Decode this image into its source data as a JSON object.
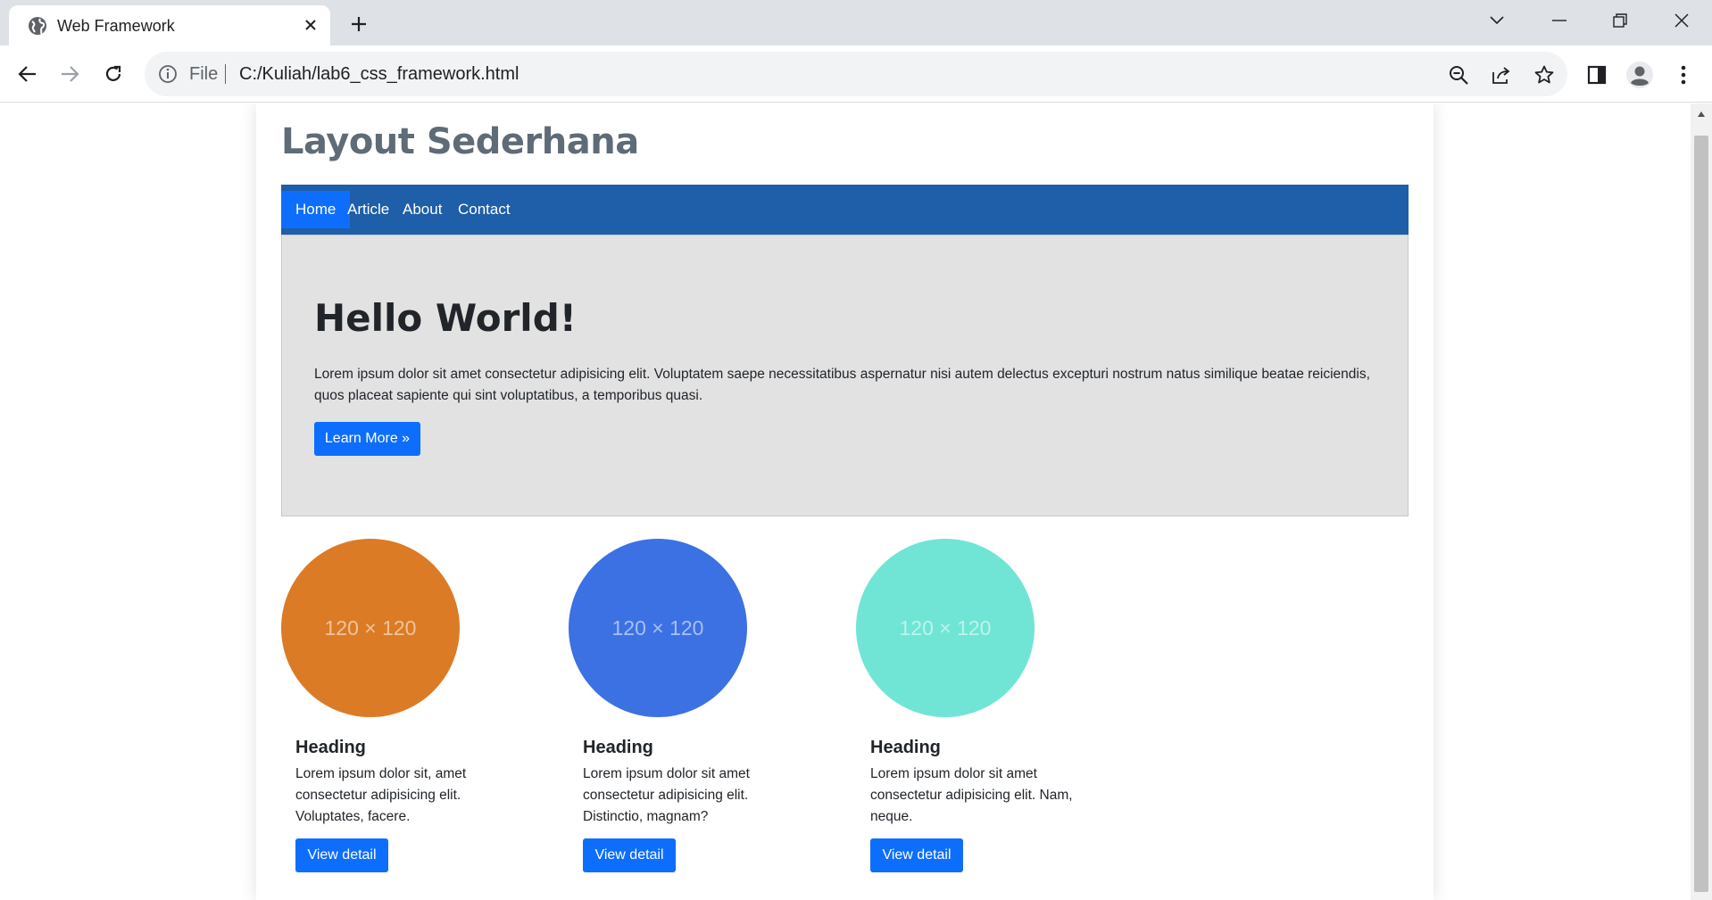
{
  "browser": {
    "tab_title": "Web Framework",
    "omnibox_scheme": "File",
    "url": "C:/Kuliah/lab6_css_framework.html"
  },
  "page": {
    "site_title": "Layout Sederhana",
    "nav": [
      {
        "label": "Home",
        "active": true
      },
      {
        "label": "Article",
        "active": false
      },
      {
        "label": "About",
        "active": false
      },
      {
        "label": "Contact",
        "active": false
      }
    ],
    "hero": {
      "title": "Hello World!",
      "text": "Lorem ipsum dolor sit amet consectetur adipisicing elit. Voluptatem saepe necessitatibus aspernatur nisi autem delectus excepturi nostrum natus similique beatae reiciendis, quos placeat sapiente qui sint voluptatibus, a temporibus quasi.",
      "button": "Learn More »"
    },
    "cards": [
      {
        "placeholder": "120 × 120",
        "color": "#db7b25",
        "heading": "Heading",
        "text": "Lorem ipsum dolor sit, amet consectetur adipisicing elit. Voluptates, facere.",
        "button": "View detail"
      },
      {
        "placeholder": "120 × 120",
        "color": "#3c71e3",
        "heading": "Heading",
        "text": "Lorem ipsum dolor sit amet consectetur adipisicing elit. Distinctio, magnam?",
        "button": "View detail"
      },
      {
        "placeholder": "120 × 120",
        "color": "#70e5d5",
        "heading": "Heading",
        "text": "Lorem ipsum dolor sit amet consectetur adipisicing elit. Nam, neque.",
        "button": "View detail"
      }
    ]
  },
  "colors": {
    "navbar": "#1f5ea8",
    "primary": "#0d6efd",
    "hero_bg": "#e2e2e3"
  },
  "icons": {
    "tab_favicon": "globe-icon",
    "tab_close": "close-icon",
    "new_tab": "plus-icon",
    "back": "back-arrow-icon",
    "forward": "forward-arrow-icon",
    "reload": "reload-icon",
    "site_info": "info-icon",
    "zoom": "zoom-out-icon",
    "share": "share-icon",
    "bookmark": "star-icon",
    "side_panel": "side-panel-icon",
    "profile": "profile-icon",
    "menu": "kebab-menu-icon"
  }
}
